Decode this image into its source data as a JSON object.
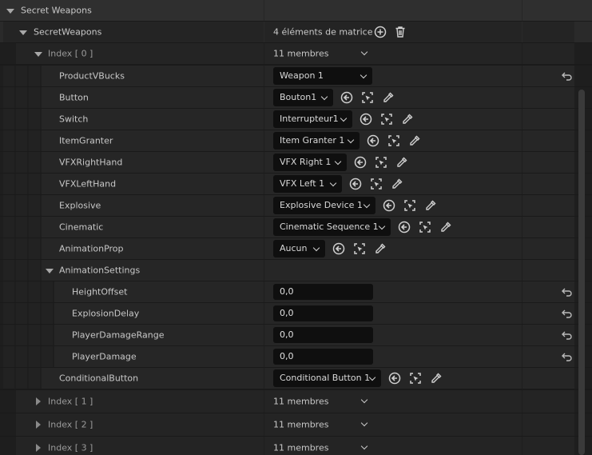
{
  "category": {
    "label": "Secret Weapons"
  },
  "array": {
    "label": "SecretWeapons",
    "count_text": "4 éléments de matrice"
  },
  "index0": {
    "label": "Index [ 0 ]",
    "members": "11 membres"
  },
  "fields": {
    "product": {
      "label": "ProductVBucks",
      "value": "Weapon 1"
    },
    "button": {
      "label": "Button",
      "value": "Bouton1"
    },
    "switch": {
      "label": "Switch",
      "value": "Interrupteur1"
    },
    "granter": {
      "label": "ItemGranter",
      "value": "Item Granter 1"
    },
    "vfxright": {
      "label": "VFXRightHand",
      "value": "VFX Right 1"
    },
    "vfxleft": {
      "label": "VFXLeftHand",
      "value": "VFX Left 1"
    },
    "explosive": {
      "label": "Explosive",
      "value": "Explosive Device 1"
    },
    "cinematic": {
      "label": "Cinematic",
      "value": "Cinematic Sequence 1"
    },
    "animprop": {
      "label": "AnimationProp",
      "value": "Aucun"
    },
    "animsettings": {
      "label": "AnimationSettings"
    },
    "height": {
      "label": "HeightOffset",
      "value": "0,0"
    },
    "explosion": {
      "label": "ExplosionDelay",
      "value": "0,0"
    },
    "range": {
      "label": "PlayerDamageRange",
      "value": "0,0"
    },
    "damage": {
      "label": "PlayerDamage",
      "value": "0,0"
    },
    "conditional": {
      "label": "ConditionalButton",
      "value": "Conditional Button 1"
    }
  },
  "index1": {
    "label": "Index [ 1 ]",
    "members": "11 membres"
  },
  "index2": {
    "label": "Index [ 2 ]",
    "members": "11 membres"
  },
  "index3": {
    "label": "Index [ 3 ]",
    "members": "11 membres"
  },
  "colors": {
    "row_bg": "#242424",
    "row_alt_bg": "#262626",
    "category_bg": "#2f2f2f",
    "field_bg": "#0f0f0f"
  },
  "icons": [
    "add-element-icon",
    "delete-icon",
    "use-selected-icon",
    "browse-icon",
    "picker-icon",
    "reset-icon"
  ]
}
